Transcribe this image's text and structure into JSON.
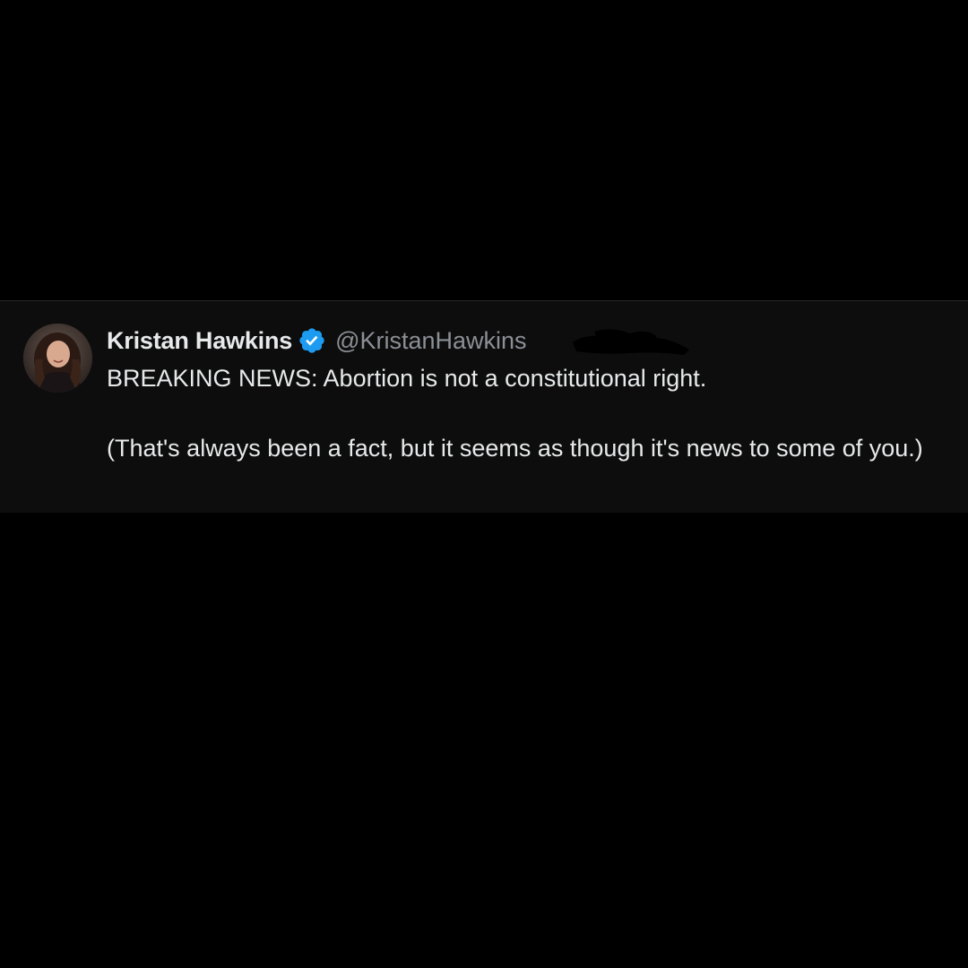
{
  "tweet": {
    "display_name": "Kristan Hawkins",
    "verified_icon": "verified-badge-icon",
    "handle": "@KristanHawkins",
    "text": "BREAKING NEWS: Abortion is not a constitutional right.\n\n(That's always been a fact, but it seems as though it's news to some of you.)"
  },
  "colors": {
    "background": "#000000",
    "card": "#0d0d0d",
    "text": "#e7e9ea",
    "handle": "#8b9096",
    "verified": "#1d9bf0"
  }
}
